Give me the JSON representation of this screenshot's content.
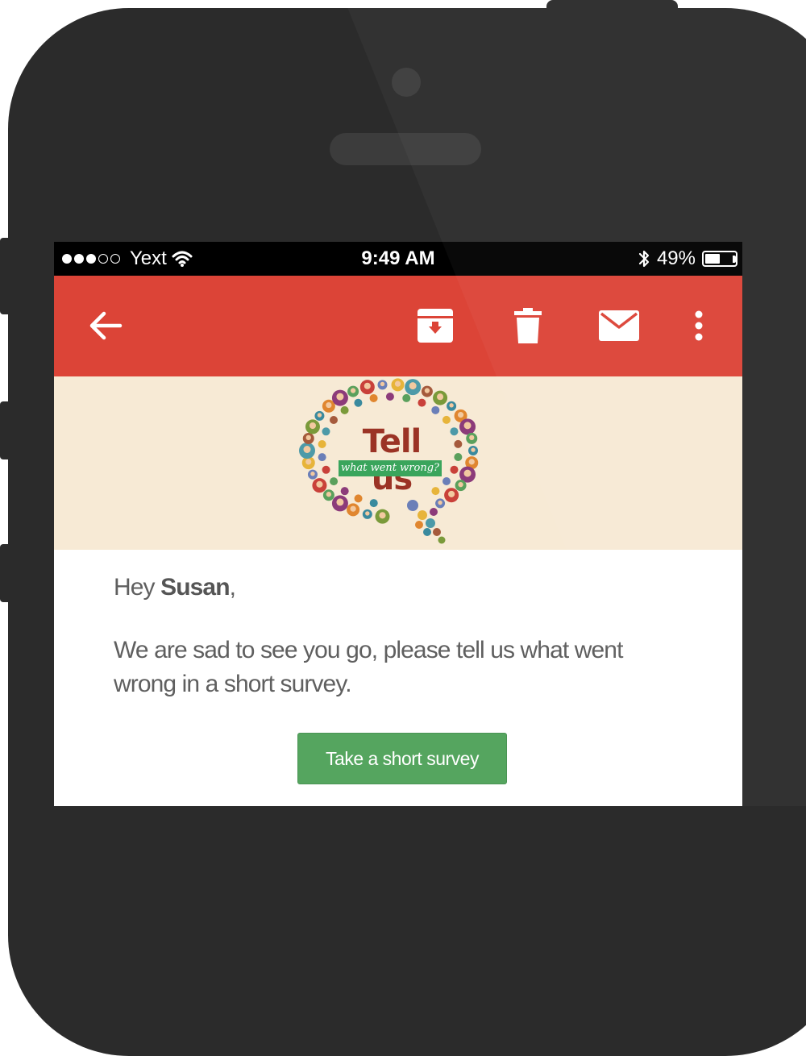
{
  "status_bar": {
    "carrier": "Yext",
    "time": "9:49 AM",
    "battery_percent": "49%",
    "battery_level": 0.49,
    "signal_bars_filled": 3,
    "signal_bars_total": 5
  },
  "toolbar": {
    "icons": [
      "back-arrow-icon",
      "archive-icon",
      "trash-icon",
      "mail-icon",
      "more-vertical-icon"
    ],
    "color": "#dc4437"
  },
  "banner": {
    "headline": "Tell us",
    "subline": "what went wrong?",
    "background": "#f7ead5"
  },
  "email": {
    "greeting_prefix": "Hey ",
    "recipient_name": "Susan",
    "greeting_suffix": ",",
    "message": "We are sad to see you go, please tell us what went wrong in a short survey.",
    "cta_label": "Take a short survey",
    "cta_color": "#55a55f"
  }
}
